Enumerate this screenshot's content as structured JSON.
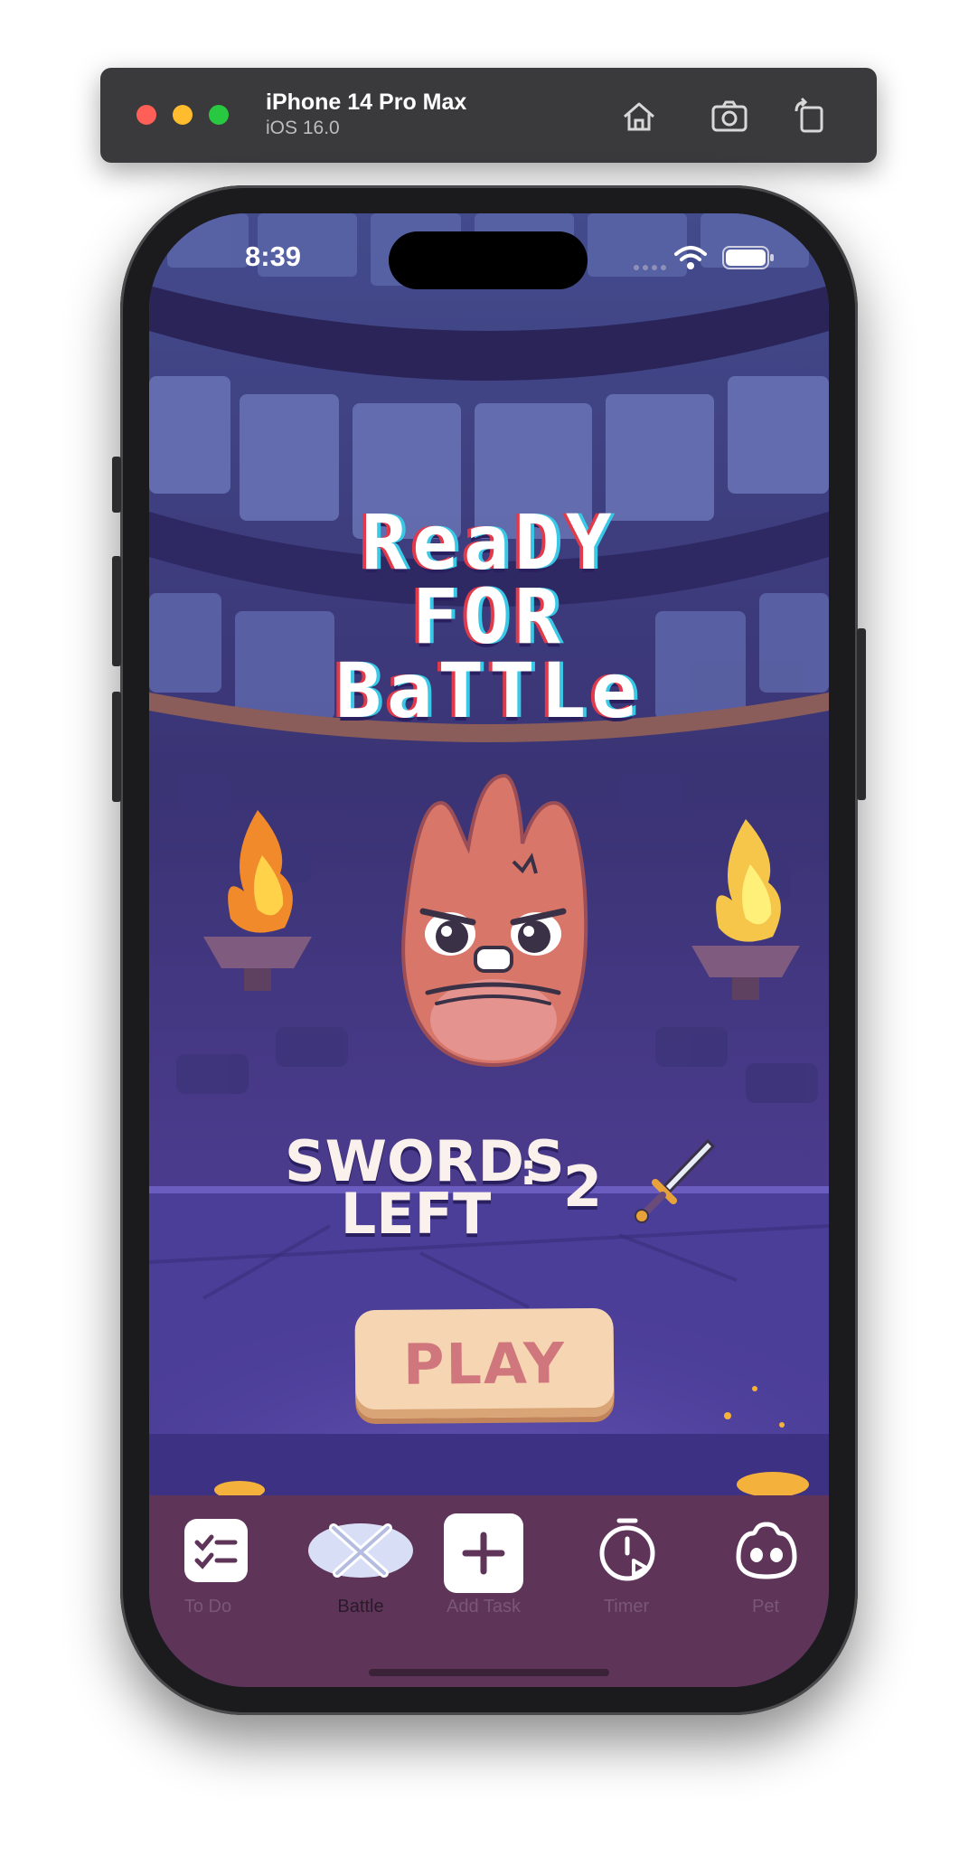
{
  "simulator": {
    "device_name": "iPhone 14 Pro Max",
    "os_version": "iOS 16.0",
    "buttons": [
      "home-icon",
      "screenshot-icon",
      "rotate-icon"
    ]
  },
  "status_bar": {
    "time": "8:39"
  },
  "battle": {
    "title_lines": [
      "ReaDY",
      "FOR",
      "BaTTLe"
    ],
    "swords_label": "SWORDS LEFT",
    "swords_label_line1": "SWORDS",
    "swords_label_line2": "LEFT",
    "swords_colon": ":",
    "swords_count": "2",
    "play_label": "PLAY"
  },
  "tab_bar": {
    "items": [
      {
        "label": "To Do",
        "icon": "checklist-icon",
        "active": false
      },
      {
        "label": "Battle",
        "icon": "crossed-swords-icon",
        "active": true
      },
      {
        "label": "Add Task",
        "icon": "plus-icon",
        "active": false
      },
      {
        "label": "Timer",
        "icon": "timer-icon",
        "active": false
      },
      {
        "label": "Pet",
        "icon": "pet-icon",
        "active": false
      }
    ]
  },
  "colors": {
    "scene_background": "#46357c",
    "tab_bar": "#5e3559",
    "play_button": "#f6d6b2",
    "play_text": "#d0777d",
    "character": "#d9766a"
  }
}
